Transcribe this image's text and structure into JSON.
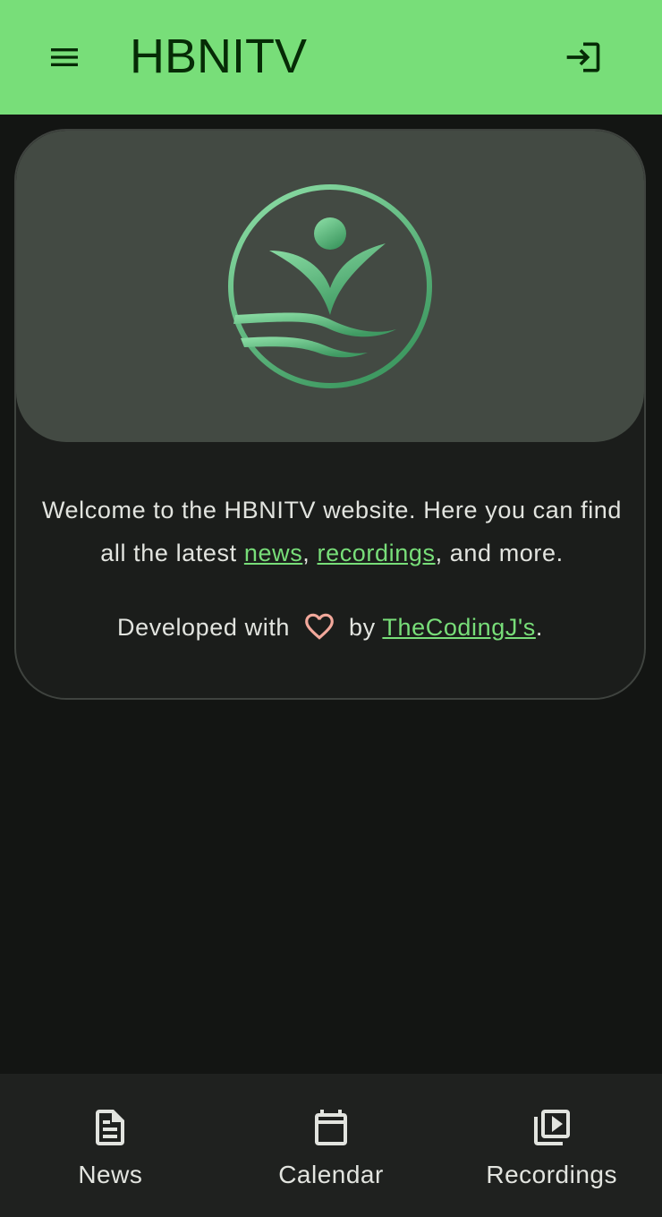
{
  "header": {
    "title": "HBNITV",
    "menu_icon": "menu-icon",
    "login_icon": "login-icon"
  },
  "card": {
    "logo_icon": "hbnitv-logo",
    "welcome_before": "Welcome to the HBNITV website. Here you can find all the latest ",
    "news_link": "news",
    "separator": ", ",
    "recordings_link": "recordings",
    "welcome_after": ", and more.",
    "credit_before": "Developed with",
    "heart_icon": "heart-icon",
    "credit_by": "by",
    "author_link": "TheCodingJ's",
    "credit_end": "."
  },
  "bottom_nav": {
    "items": [
      {
        "label": "News",
        "icon": "article-icon"
      },
      {
        "label": "Calendar",
        "icon": "calendar-icon"
      },
      {
        "label": "Recordings",
        "icon": "video-library-icon"
      }
    ]
  },
  "colors": {
    "accent": "#78de79",
    "header_text": "#062b06",
    "background": "#131513",
    "card": "#1b1d1b",
    "card_media": "#434a43",
    "heart": "#f2a89b",
    "logo_light": "#8fe0a8",
    "logo_dark": "#3f9a62"
  }
}
